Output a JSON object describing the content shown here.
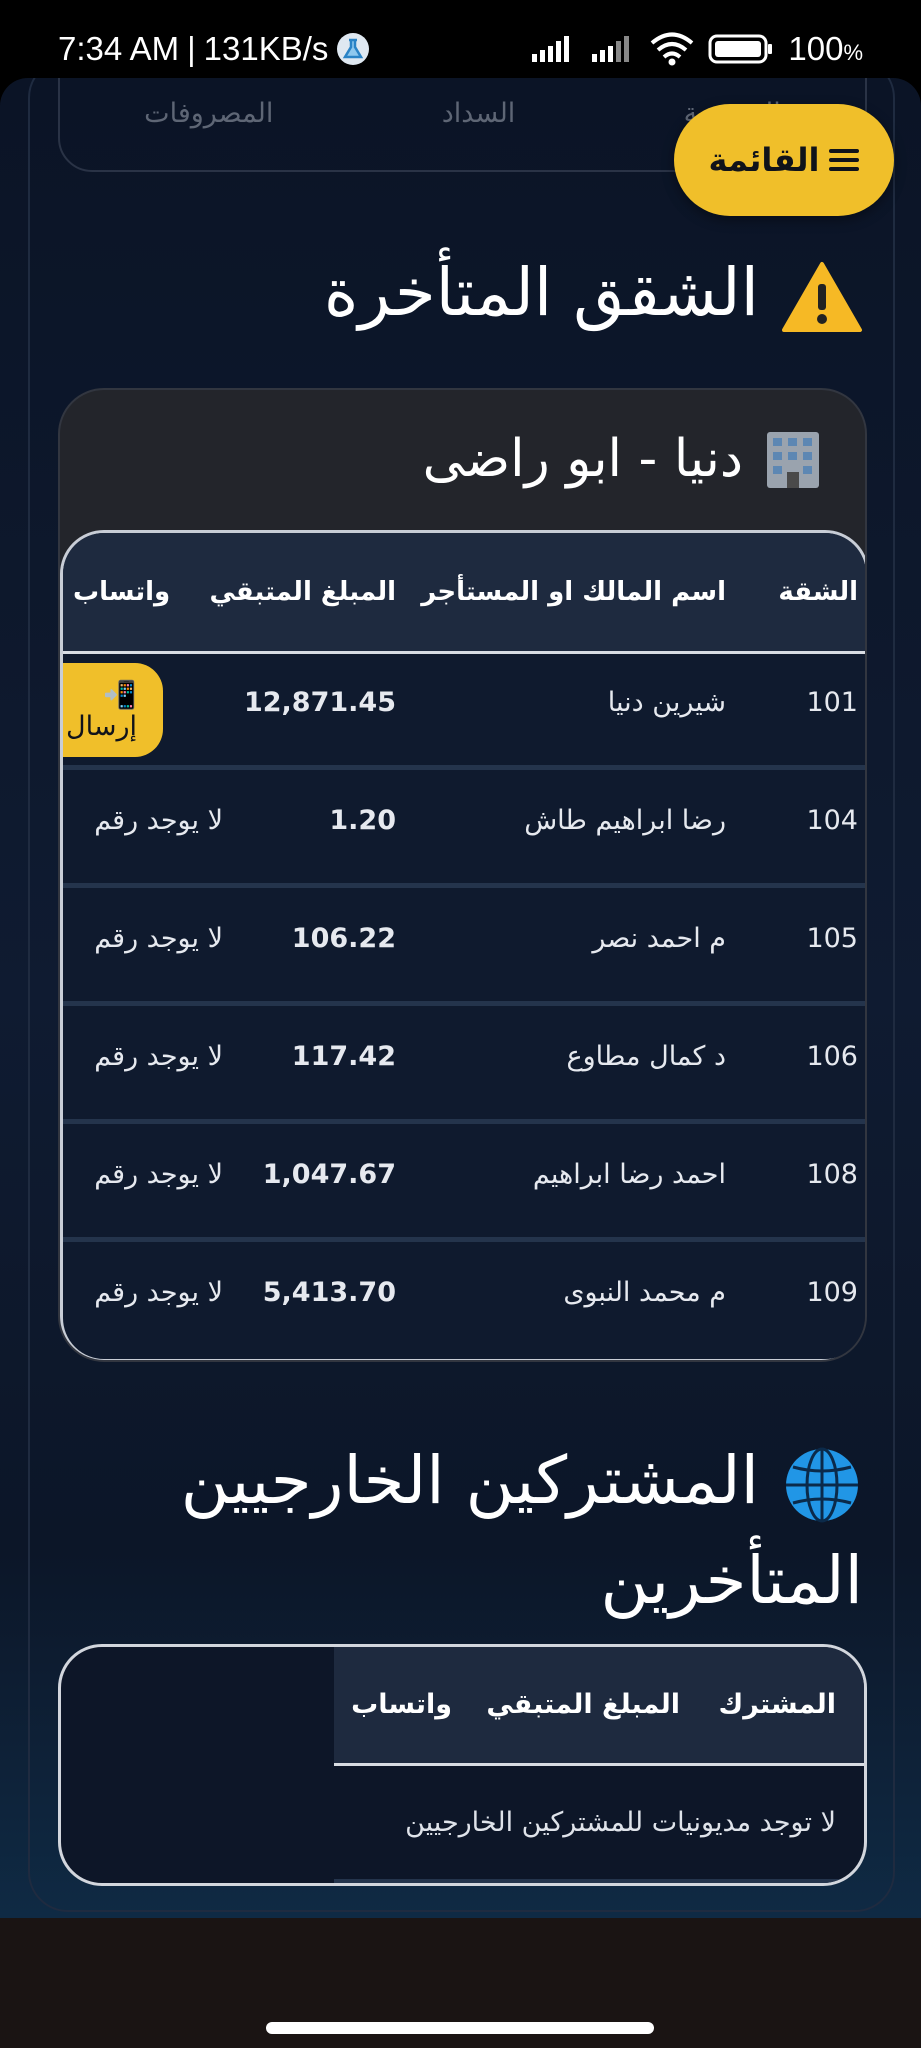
{
  "status_bar": {
    "time": "7:34 AM",
    "separator": "|",
    "speed": "131KB/s",
    "battery": "100",
    "battery_unit": "%"
  },
  "summary": {
    "labels": [
      "المديونية",
      "السداد",
      "المصروفات"
    ]
  },
  "menu": {
    "label": "القائمة",
    "icon": "hamburger-icon"
  },
  "late_apartments": {
    "title": "الشقق المتأخرة",
    "icon": "warning-icon",
    "building": {
      "name": "دنيا - ابو راضى",
      "icon": "building-icon",
      "headers": {
        "apartment": "الشقة",
        "owner": "اسم المالك او المستأجر",
        "remaining": "المبلغ المتبقي",
        "whatsapp": "واتساب"
      },
      "rows": [
        {
          "apartment": "101",
          "owner": "شيرين دنيا",
          "remaining": "12,871.45",
          "whatsapp": "📲 إرسال",
          "has_button": true
        },
        {
          "apartment": "104",
          "owner": "رضا ابراهيم طاش",
          "remaining": "1.20",
          "whatsapp": "لا يوجد رقم",
          "has_button": false
        },
        {
          "apartment": "105",
          "owner": "م احمد نصر",
          "remaining": "106.22",
          "whatsapp": "لا يوجد رقم",
          "has_button": false
        },
        {
          "apartment": "106",
          "owner": "د كمال مطاوع",
          "remaining": "117.42",
          "whatsapp": "لا يوجد رقم",
          "has_button": false
        },
        {
          "apartment": "108",
          "owner": "احمد رضا ابراهيم",
          "remaining": "1,047.67",
          "whatsapp": "لا يوجد رقم",
          "has_button": false
        },
        {
          "apartment": "109",
          "owner": "م محمد النبوى",
          "remaining": "5,413.70",
          "whatsapp": "لا يوجد رقم",
          "has_button": false
        }
      ]
    }
  },
  "external_subscribers": {
    "title_line1": "المشتركين الخارجيين",
    "title_line2": "المتأخرين",
    "icon": "globe-icon",
    "headers": {
      "subscriber": "المشترك",
      "remaining": "المبلغ المتبقي",
      "whatsapp": "واتساب"
    },
    "empty_message": "لا توجد مديونيات للمشتركين الخارجيين"
  },
  "colors": {
    "accent": "#f0bf2a",
    "background": "#0f1b31",
    "table_header": "#1e2a3f"
  }
}
